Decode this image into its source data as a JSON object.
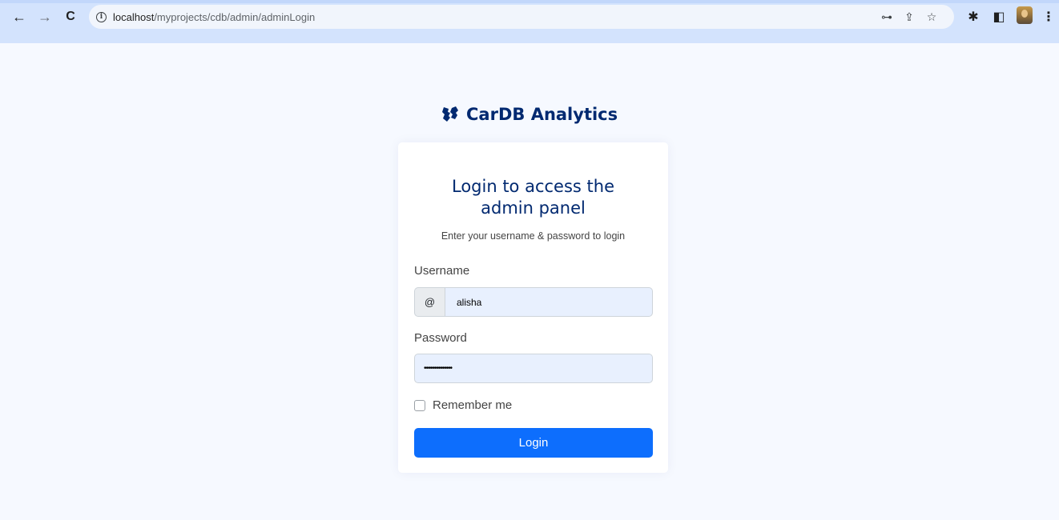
{
  "browser": {
    "back_icon": "←",
    "forward_icon": "→",
    "reload_icon": "C",
    "url_host": "localhost",
    "url_path": "/myprojects/cdb/admin/adminLogin",
    "key_icon": "⊶",
    "share_icon": "⇪",
    "star_icon": "☆",
    "extensions_icon": "✱",
    "sidepanel_icon": "◧",
    "menu_icon": "⋮"
  },
  "brand": {
    "name": "CarDB Analytics"
  },
  "login": {
    "title": "Login to access the admin panel",
    "subtitle": "Enter your username & password to login",
    "username_label": "Username",
    "username_addon": "@",
    "username_value": "alisha",
    "password_label": "Password",
    "password_value": "••••••••••••••",
    "remember_label": "Remember me",
    "button_label": "Login"
  },
  "colors": {
    "accent": "#0d6efd",
    "heading": "#012970",
    "page_bg": "#f6f9ff"
  }
}
